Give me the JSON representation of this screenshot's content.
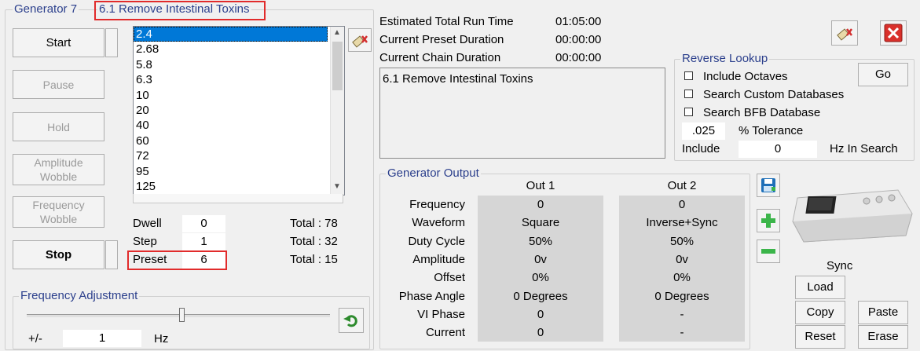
{
  "generator": {
    "label": "Generator 7",
    "preset_name": "6.1 Remove Intestinal Toxins"
  },
  "controls": {
    "start": "Start",
    "pause": "Pause",
    "hold": "Hold",
    "amp_wobble": "Amplitude Wobble",
    "freq_wobble": "Frequency Wobble",
    "stop": "Stop"
  },
  "frequencies": [
    "2.4",
    "2.68",
    "5.8",
    "6.3",
    "10",
    "20",
    "40",
    "60",
    "72",
    "95",
    "125"
  ],
  "counters": [
    {
      "label": "Dwell",
      "value": "0",
      "total": "Total : 78"
    },
    {
      "label": "Step",
      "value": "1",
      "total": "Total : 32"
    },
    {
      "label": "Preset",
      "value": "6",
      "total": "Total : 15"
    }
  ],
  "run_info": [
    {
      "label": "Estimated Total Run Time",
      "value": "01:05:00"
    },
    {
      "label": "Current Preset Duration",
      "value": "00:00:00"
    },
    {
      "label": "Current Chain Duration",
      "value": "00:00:00"
    }
  ],
  "preset_text": "6.1 Remove Intestinal Toxins",
  "reverse_lookup": {
    "title": "Reverse Lookup",
    "include_octaves": "Include Octaves",
    "search_custom": "Search Custom Databases",
    "search_bfb": "Search BFB Database",
    "go": "Go",
    "tolerance_value": ".025",
    "tolerance_label": "% Tolerance",
    "include_label": "Include",
    "include_value": "0",
    "hz_label": "Hz In Search"
  },
  "output": {
    "title": "Generator Output",
    "out1": "Out 1",
    "out2": "Out 2",
    "rows": [
      {
        "label": "Frequency",
        "o1": "0",
        "o2": "0"
      },
      {
        "label": "Waveform",
        "o1": "Square",
        "o2": "Inverse+Sync"
      },
      {
        "label": "Duty Cycle",
        "o1": "50%",
        "o2": "50%"
      },
      {
        "label": "Amplitude",
        "o1": "0v",
        "o2": "0v"
      },
      {
        "label": "Offset",
        "o1": "0%",
        "o2": "0%"
      },
      {
        "label": "Phase Angle",
        "o1": "0 Degrees",
        "o2": "0 Degrees"
      },
      {
        "label": "VI Phase",
        "o1": "0",
        "o2": "-"
      },
      {
        "label": "Current",
        "o1": "0",
        "o2": "-"
      }
    ]
  },
  "freq_adjust": {
    "title": "Frequency Adjustment",
    "pm_label": "+/-",
    "value": "1",
    "unit": "Hz"
  },
  "sync": {
    "label": "Sync",
    "load": "Load",
    "copy": "Copy",
    "reset": "Reset",
    "paste": "Paste",
    "erase": "Erase"
  },
  "colors": {
    "highlight": "#0078d7",
    "annotation": "#e12b2b",
    "group_label": "#2b3f8c"
  }
}
